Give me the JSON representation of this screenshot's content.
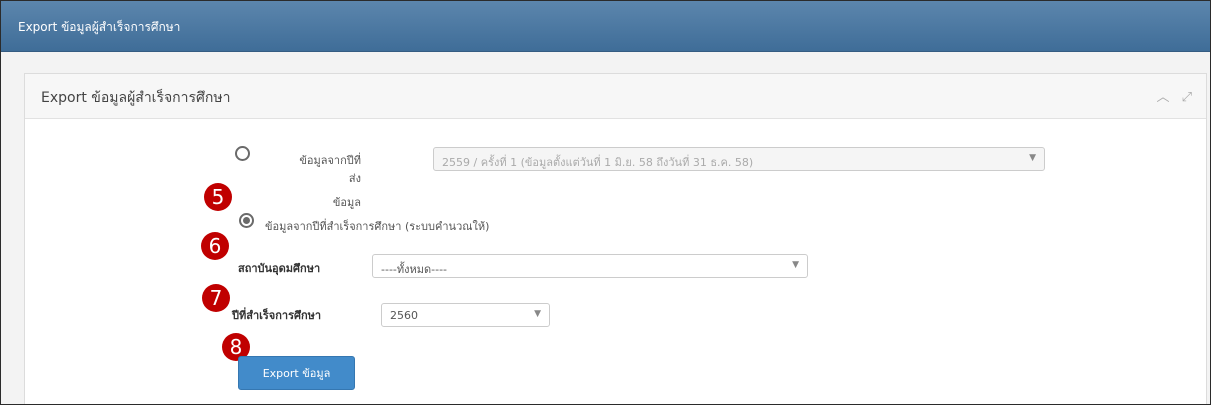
{
  "window": {
    "title": "Export ข้อมูลผู้สำเร็จการศึกษา"
  },
  "panel": {
    "title": "Export ข้อมูลผู้สำเร็จการศึกษา",
    "tools": {
      "collapse": "︿",
      "expand": "⤢"
    }
  },
  "form": {
    "option_send_year": {
      "label_line1": "ข้อมูลจากปีที่ส่ง",
      "label_line2": "ข้อมูล",
      "selected": false,
      "select_value": "2559 / ครั้งที่ 1 (ข้อมูลตั้งแต่วันที่ 1 มิ.ย. 58 ถึงวันที่ 31 ธ.ค. 58)",
      "disabled": true
    },
    "option_grad_year": {
      "label": "ข้อมูลจากปีที่สำเร็จการศึกษา (ระบบคำนวณให้)",
      "selected": true
    },
    "institution": {
      "label": "สถาบันอุดมศึกษา",
      "value": "----ทั้งหมด----"
    },
    "grad_year": {
      "label": "ปีที่สำเร็จการศึกษา",
      "value": "2560"
    },
    "export_button": "Export ข้อมูล"
  },
  "markers": [
    "5",
    "6",
    "7",
    "8"
  ],
  "colors": {
    "header_bar": "#4a77a1",
    "primary_button": "#428bca",
    "marker": "#c00000"
  }
}
